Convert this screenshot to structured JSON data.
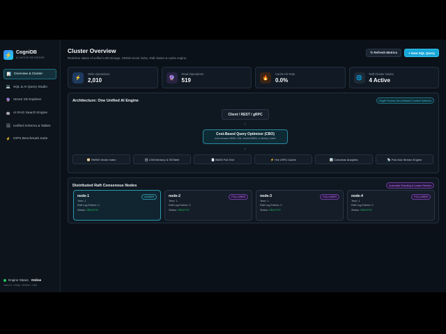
{
  "brand": {
    "name": "CogniDB",
    "tagline": "AI-NATIVE DB ENGINE"
  },
  "sidebar": {
    "items": [
      {
        "icon": "chart-icon",
        "glyph": "📊",
        "label": "Overview & Cluster",
        "active": true
      },
      {
        "icon": "terminal-icon",
        "glyph": "💻",
        "label": "SQL & AI Query Studio"
      },
      {
        "icon": "cube-icon",
        "glyph": "🔮",
        "label": "Vector 2D Explorer"
      },
      {
        "icon": "robot-icon",
        "glyph": "🤖",
        "label": "AI RAG Search Engine"
      },
      {
        "icon": "table-icon",
        "glyph": "🗄",
        "label": "Unified Schema & Tables"
      },
      {
        "icon": "bolt-icon",
        "glyph": "⚡",
        "label": "IOPS Benchmark Suite"
      }
    ],
    "engine_label": "Engine Status:",
    "engine_status": "Online",
    "engine_version": "Java 21 • Netty • HNSW • LSM"
  },
  "header": {
    "title": "Cluster Overview",
    "subtitle": "Real-time status of unified LSM storage, HNSW vector index, Raft cluster & cache engine.",
    "refresh_label": "↻ Refresh Metrics",
    "new_query_label": "+ New SQL Query"
  },
  "stats": [
    {
      "icon": "bolt-icon",
      "glyph": "⚡",
      "label": "Write Operations",
      "value": "2,010",
      "color": "#1e3a5f"
    },
    {
      "icon": "read-icon",
      "glyph": "🔮",
      "label": "Read Operations",
      "value": "519",
      "color": "#2a2344"
    },
    {
      "icon": "fire-icon",
      "glyph": "🔥",
      "label": "Cache Hit Rate",
      "value": "0.0%",
      "color": "#3a2416"
    },
    {
      "icon": "globe-icon",
      "glyph": "🌐",
      "label": "Raft Cluster Nodes",
      "value": "4 Active",
      "color": "#1e2a35"
    }
  ],
  "architecture": {
    "title": "Architecture: One Unified AI Engine",
    "badge": "Single Process Zero-Network Context Switches",
    "client": "Client / REST / gRPC",
    "cbo_title": "Cost-Based Query Optimizer (CBO)",
    "cbo_desc": "Auto-chooses HNSW, LSM, Inverted BM25, or Memory Cache",
    "modules": [
      "🧭 HNSW Vector Index",
      "🗄 LSM Memory & SSTable",
      "📄 BM25 Full-Text",
      "⚡ Hot LRFU Cache",
      "📊 Columnar Analytics",
      "📡 Pub-Sub Stream Engine"
    ]
  },
  "raft": {
    "title": "Distributed Raft Consensus Nodes",
    "badge": "Automatic Sharding & Leader Election",
    "nodes": [
      {
        "name": "node-1",
        "role": "LEADER",
        "term": "Term: 1",
        "log": "Raft Log Entries: 0",
        "status_label": "Status:",
        "status": "HEALTHY"
      },
      {
        "name": "node-2",
        "role": "FOLLOWER",
        "term": "Term: 1",
        "log": "Raft Log Entries: 0",
        "status_label": "Status:",
        "status": "HEALTHY"
      },
      {
        "name": "node-3",
        "role": "FOLLOWER",
        "term": "Term: 1",
        "log": "Raft Log Entries: 0",
        "status_label": "Status:",
        "status": "HEALTHY"
      },
      {
        "name": "node-4",
        "role": "FOLLOWER",
        "term": "Term: 1",
        "log": "Raft Log Entries: 0",
        "status_label": "Status:",
        "status": "HEALTHY"
      }
    ]
  },
  "colors": {
    "accent": "#18a6d8",
    "healthy": "#22c55e",
    "follower": "#c084fc"
  }
}
